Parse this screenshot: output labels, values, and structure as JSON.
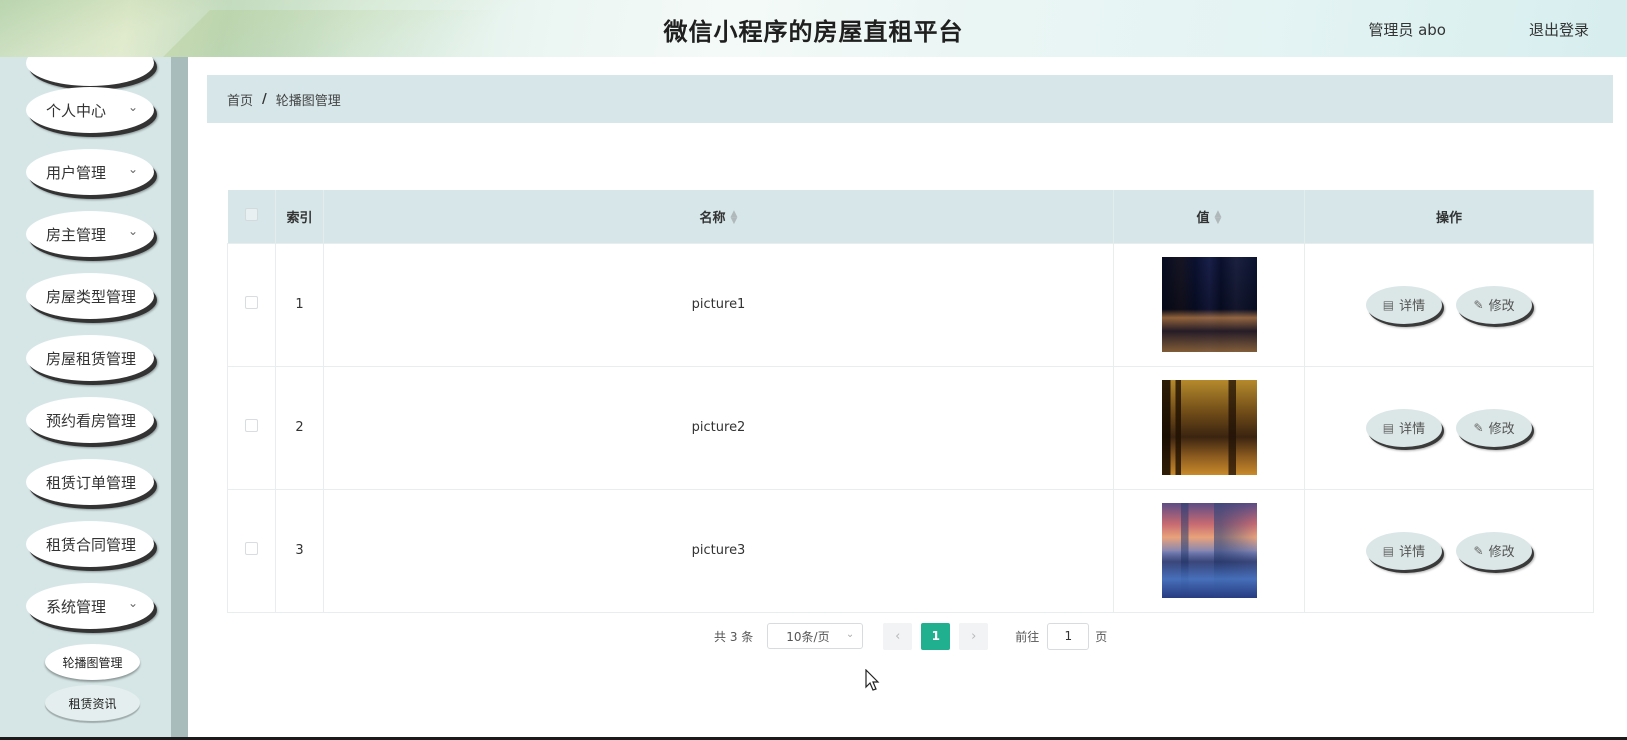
{
  "header": {
    "title": "微信小程序的房屋直租平台",
    "admin_label": "管理员 abo",
    "logout_label": "退出登录"
  },
  "sidebar": {
    "items": [
      {
        "label": "个人中心",
        "chevron": "⌄"
      },
      {
        "label": "用户管理",
        "chevron": "⌄"
      },
      {
        "label": "房主管理",
        "chevron": "⌄"
      },
      {
        "label": "房屋类型管理"
      },
      {
        "label": "房屋租赁管理"
      },
      {
        "label": "预约看房管理"
      },
      {
        "label": "租赁订单管理"
      },
      {
        "label": "租赁合同管理"
      },
      {
        "label": "系统管理",
        "chevron": "⌄"
      }
    ],
    "sub_items": [
      {
        "label": "轮播图管理"
      },
      {
        "label": "租赁资讯"
      }
    ]
  },
  "breadcrumb": {
    "home": "首页",
    "separator": "/",
    "current": "轮播图管理"
  },
  "table": {
    "columns": {
      "index": "索引",
      "name": "名称",
      "value": "值",
      "actions": "操作"
    },
    "rows": [
      {
        "index": "1",
        "name": "picture1",
        "image": "city-night-reflection"
      },
      {
        "index": "2",
        "name": "picture2",
        "image": "golden-building-reflection"
      },
      {
        "index": "3",
        "name": "picture3",
        "image": "skyline-sunset-water"
      }
    ],
    "detail_label": "详情",
    "edit_label": "修改",
    "detail_icon": "document-icon",
    "edit_icon": "pencil-icon"
  },
  "pagination": {
    "total": "共 3 条",
    "page_size": "10条/页",
    "prev": "‹",
    "current_page": "1",
    "next": "›",
    "goto_label": "前往",
    "goto_value": "1",
    "page_suffix": "页"
  },
  "colors": {
    "accent": "#21b08f",
    "sidebar_bg": "#d6e6e6",
    "table_header_bg": "#d6e6e9"
  }
}
